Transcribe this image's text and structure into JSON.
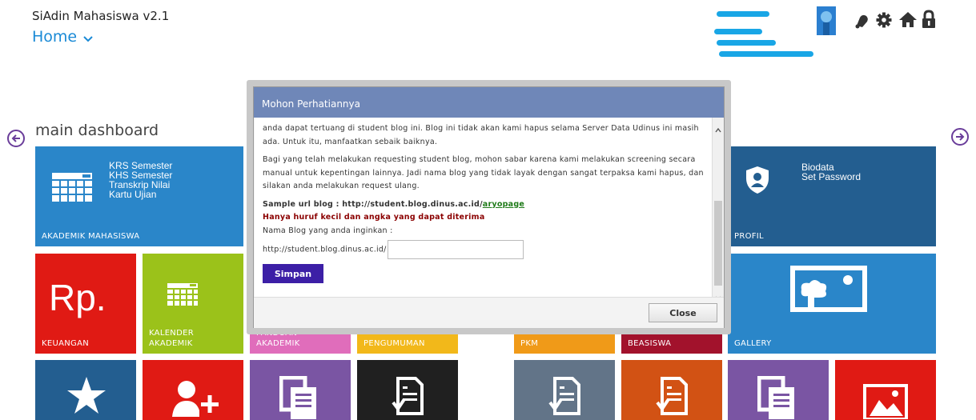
{
  "header": {
    "app_title": "SiAdin Mahasiswa v2.1",
    "home_label": "Home"
  },
  "dashboard": {
    "heading": "main dashboard"
  },
  "tiles": {
    "akademik": {
      "caption": "AKADEMIK MAHASISWA",
      "lines": [
        "KRS Semester",
        "KHS Semester",
        "Transkrip Nilai",
        "Kartu Ujian"
      ]
    },
    "profil": {
      "caption": "PROFIL",
      "lines": [
        "Biodata",
        "Set Password"
      ]
    },
    "keuangan": {
      "caption": "KEUANGAN",
      "symbol": "Rp."
    },
    "kalender": {
      "caption": "KALENDER AKADEMIK"
    },
    "panduan": {
      "caption": "PANDUAN AKADEMIK"
    },
    "pengumuman": {
      "caption": "PENGUMUMAN"
    },
    "pkm": {
      "caption": "PKM"
    },
    "beasiswa": {
      "caption": "BEASISWA"
    },
    "gallery": {
      "caption": "GALLERY"
    }
  },
  "modal": {
    "title": "Mohon Perhatiannya",
    "para1": "anda dapat tertuang di student blog ini. Blog ini tidak akan kami hapus selama Server Data Udinus ini masih ada. Untuk itu, manfaatkan sebaik baiknya.",
    "para2": "Bagi yang telah melakukan requesting student blog, mohon sabar karena kami melakukan screening secara manual untuk kepentingan lainnya. Jadi nama blog yang tidak layak dengan sangat terpaksa kami hapus, dan silakan anda melakukan request ulang.",
    "sample_prefix": "Sample url blog : http://student.blog.dinus.ac.id/",
    "sample_link": "aryopage",
    "warning": "Hanya huruf kecil dan angka yang dapat diterima",
    "field_label": "Nama Blog yang anda inginkan :",
    "url_prefix": "http://student.blog.dinus.ac.id/",
    "input_value": "",
    "save_label": "Simpan",
    "close_label": "Close"
  },
  "colors": {
    "accent_blue": "#1a8ad6",
    "tile_blue": "#2a86c9",
    "tile_dark_blue": "#235e90",
    "tile_red": "#e01a14",
    "tile_green": "#9bc21a",
    "tile_pink": "#e06dbb",
    "tile_yellow": "#f2b81a",
    "tile_orange": "#f09a18",
    "tile_crimson": "#a2122c",
    "tile_purple": "#7a55a3",
    "tile_slate": "#627488",
    "tile_dark_orange": "#d25214",
    "modal_header": "#6f87b8",
    "save_button": "#3c1fa6"
  }
}
